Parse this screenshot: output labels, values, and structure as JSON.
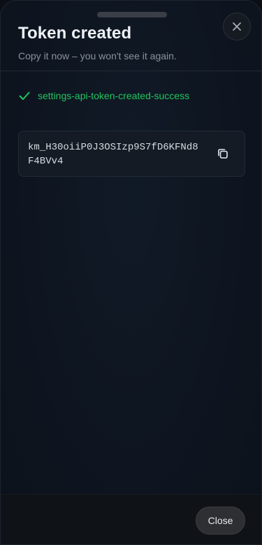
{
  "header": {
    "title": "Token created",
    "subtitle": "Copy it now – you won't see it again."
  },
  "status": {
    "message": "settings-api-token-created-success",
    "icon": "check-icon",
    "color": "#22c55e"
  },
  "token": {
    "value": "km_H30oiiP0J3OSIzp9S7fD6KFNd8F4BVv4",
    "copy_icon": "copy-icon"
  },
  "footer": {
    "close_label": "Close"
  },
  "icons": {
    "dismiss": "close-icon",
    "grabber": "drag-handle"
  }
}
